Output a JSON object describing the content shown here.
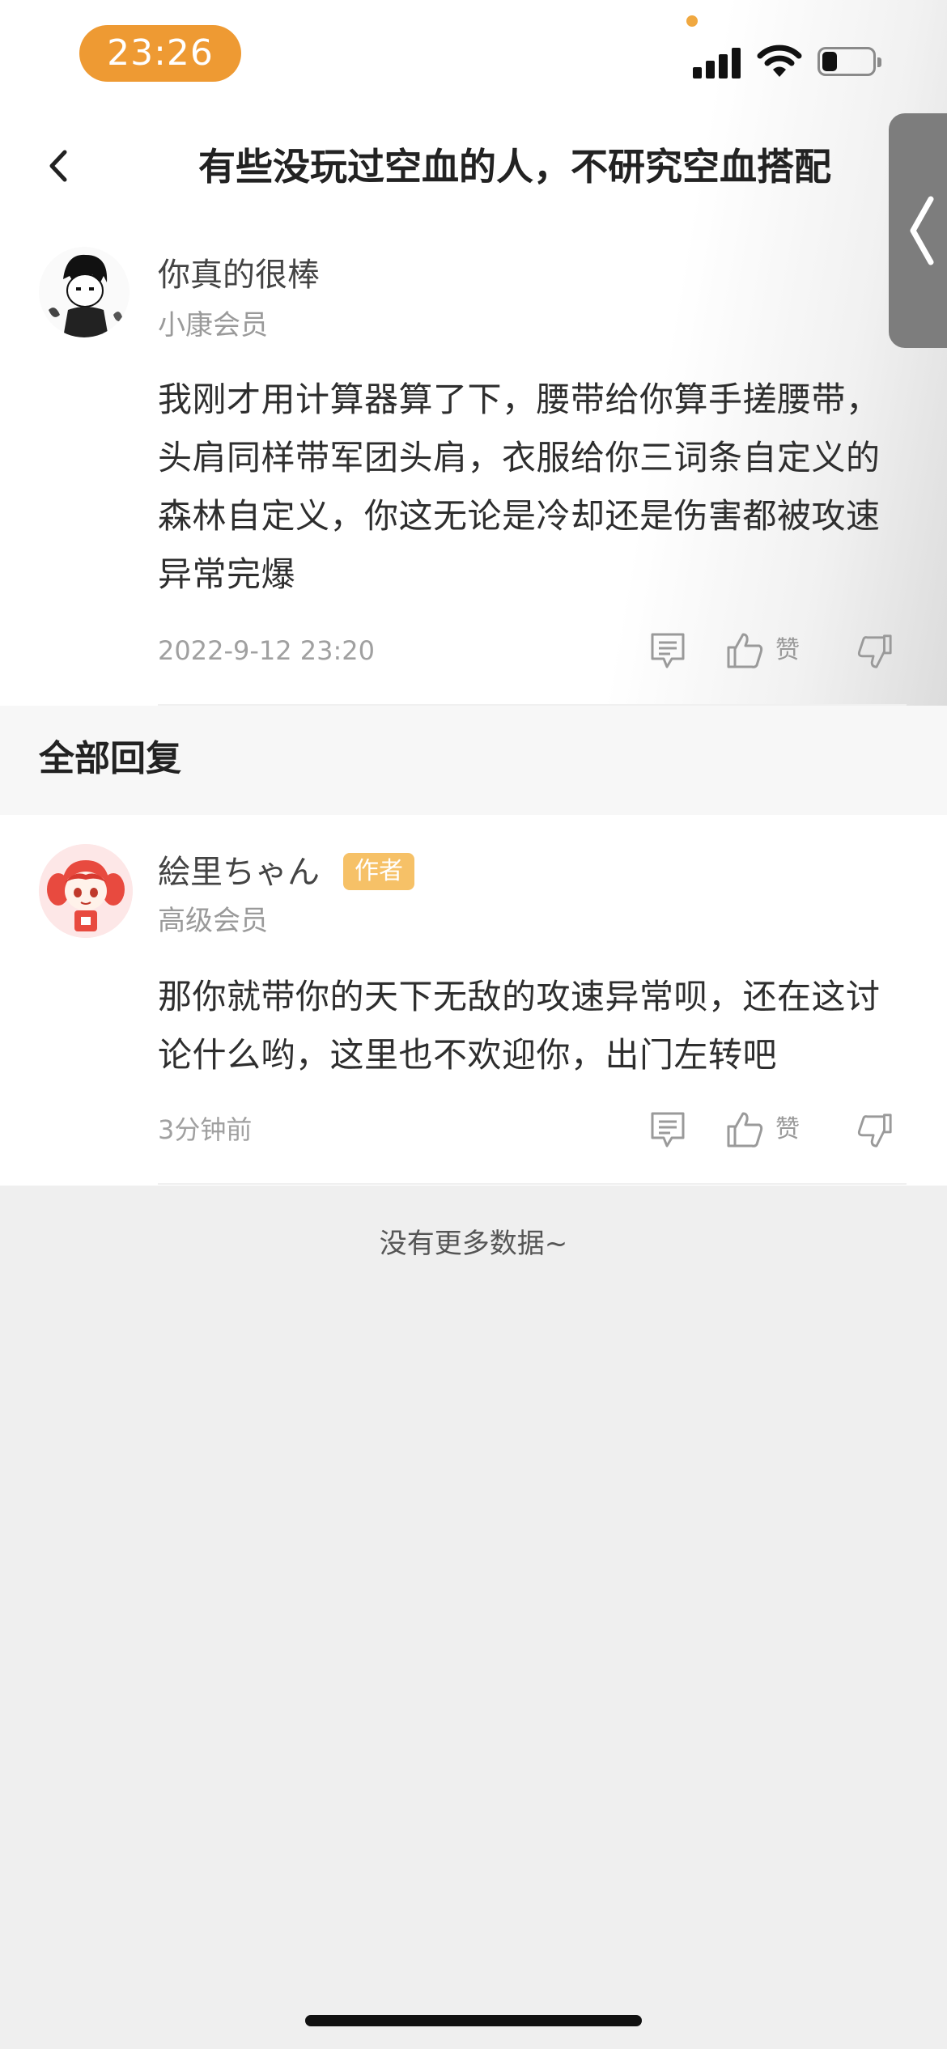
{
  "status_bar": {
    "time": "23:26"
  },
  "header": {
    "title": "有些没玩过空血的人，不研究空血搭配"
  },
  "comment": {
    "username": "你真的很棒",
    "member_level": "小康会员",
    "text": "我刚才用计算器算了下，腰带给你算手搓腰带，头肩同样带军团头肩，衣服给你三词条自定义的森林自定义，你这无论是冷却还是伤害都被攻速异常完爆",
    "timestamp": "2022-9-12 23:20",
    "like_label": "赞"
  },
  "replies_section": {
    "title": "全部回复"
  },
  "reply": {
    "username": "絵里ちゃん",
    "badge": "作者",
    "member_level": "高级会员",
    "text": "那你就带你的天下无敌的攻速异常呗，还在这讨论什么哟，这里也不欢迎你，出门左转吧",
    "timestamp": "3分钟前",
    "like_label": "赞"
  },
  "footer": {
    "no_more": "没有更多数据~"
  },
  "colors": {
    "accent": "#ee9a33",
    "badge": "#f6c167",
    "background": "#efefef"
  }
}
